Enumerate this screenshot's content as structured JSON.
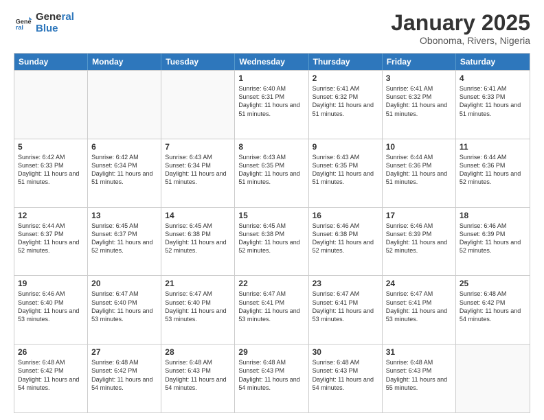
{
  "header": {
    "logo_line1": "General",
    "logo_line2": "Blue",
    "main_title": "January 2025",
    "subtitle": "Obonoma, Rivers, Nigeria"
  },
  "days_of_week": [
    "Sunday",
    "Monday",
    "Tuesday",
    "Wednesday",
    "Thursday",
    "Friday",
    "Saturday"
  ],
  "weeks": [
    [
      {
        "day": "",
        "sunrise": "",
        "sunset": "",
        "daylight": ""
      },
      {
        "day": "",
        "sunrise": "",
        "sunset": "",
        "daylight": ""
      },
      {
        "day": "",
        "sunrise": "",
        "sunset": "",
        "daylight": ""
      },
      {
        "day": "1",
        "sunrise": "Sunrise: 6:40 AM",
        "sunset": "Sunset: 6:31 PM",
        "daylight": "Daylight: 11 hours and 51 minutes."
      },
      {
        "day": "2",
        "sunrise": "Sunrise: 6:41 AM",
        "sunset": "Sunset: 6:32 PM",
        "daylight": "Daylight: 11 hours and 51 minutes."
      },
      {
        "day": "3",
        "sunrise": "Sunrise: 6:41 AM",
        "sunset": "Sunset: 6:32 PM",
        "daylight": "Daylight: 11 hours and 51 minutes."
      },
      {
        "day": "4",
        "sunrise": "Sunrise: 6:41 AM",
        "sunset": "Sunset: 6:33 PM",
        "daylight": "Daylight: 11 hours and 51 minutes."
      }
    ],
    [
      {
        "day": "5",
        "sunrise": "Sunrise: 6:42 AM",
        "sunset": "Sunset: 6:33 PM",
        "daylight": "Daylight: 11 hours and 51 minutes."
      },
      {
        "day": "6",
        "sunrise": "Sunrise: 6:42 AM",
        "sunset": "Sunset: 6:34 PM",
        "daylight": "Daylight: 11 hours and 51 minutes."
      },
      {
        "day": "7",
        "sunrise": "Sunrise: 6:43 AM",
        "sunset": "Sunset: 6:34 PM",
        "daylight": "Daylight: 11 hours and 51 minutes."
      },
      {
        "day": "8",
        "sunrise": "Sunrise: 6:43 AM",
        "sunset": "Sunset: 6:35 PM",
        "daylight": "Daylight: 11 hours and 51 minutes."
      },
      {
        "day": "9",
        "sunrise": "Sunrise: 6:43 AM",
        "sunset": "Sunset: 6:35 PM",
        "daylight": "Daylight: 11 hours and 51 minutes."
      },
      {
        "day": "10",
        "sunrise": "Sunrise: 6:44 AM",
        "sunset": "Sunset: 6:36 PM",
        "daylight": "Daylight: 11 hours and 51 minutes."
      },
      {
        "day": "11",
        "sunrise": "Sunrise: 6:44 AM",
        "sunset": "Sunset: 6:36 PM",
        "daylight": "Daylight: 11 hours and 52 minutes."
      }
    ],
    [
      {
        "day": "12",
        "sunrise": "Sunrise: 6:44 AM",
        "sunset": "Sunset: 6:37 PM",
        "daylight": "Daylight: 11 hours and 52 minutes."
      },
      {
        "day": "13",
        "sunrise": "Sunrise: 6:45 AM",
        "sunset": "Sunset: 6:37 PM",
        "daylight": "Daylight: 11 hours and 52 minutes."
      },
      {
        "day": "14",
        "sunrise": "Sunrise: 6:45 AM",
        "sunset": "Sunset: 6:38 PM",
        "daylight": "Daylight: 11 hours and 52 minutes."
      },
      {
        "day": "15",
        "sunrise": "Sunrise: 6:45 AM",
        "sunset": "Sunset: 6:38 PM",
        "daylight": "Daylight: 11 hours and 52 minutes."
      },
      {
        "day": "16",
        "sunrise": "Sunrise: 6:46 AM",
        "sunset": "Sunset: 6:38 PM",
        "daylight": "Daylight: 11 hours and 52 minutes."
      },
      {
        "day": "17",
        "sunrise": "Sunrise: 6:46 AM",
        "sunset": "Sunset: 6:39 PM",
        "daylight": "Daylight: 11 hours and 52 minutes."
      },
      {
        "day": "18",
        "sunrise": "Sunrise: 6:46 AM",
        "sunset": "Sunset: 6:39 PM",
        "daylight": "Daylight: 11 hours and 52 minutes."
      }
    ],
    [
      {
        "day": "19",
        "sunrise": "Sunrise: 6:46 AM",
        "sunset": "Sunset: 6:40 PM",
        "daylight": "Daylight: 11 hours and 53 minutes."
      },
      {
        "day": "20",
        "sunrise": "Sunrise: 6:47 AM",
        "sunset": "Sunset: 6:40 PM",
        "daylight": "Daylight: 11 hours and 53 minutes."
      },
      {
        "day": "21",
        "sunrise": "Sunrise: 6:47 AM",
        "sunset": "Sunset: 6:40 PM",
        "daylight": "Daylight: 11 hours and 53 minutes."
      },
      {
        "day": "22",
        "sunrise": "Sunrise: 6:47 AM",
        "sunset": "Sunset: 6:41 PM",
        "daylight": "Daylight: 11 hours and 53 minutes."
      },
      {
        "day": "23",
        "sunrise": "Sunrise: 6:47 AM",
        "sunset": "Sunset: 6:41 PM",
        "daylight": "Daylight: 11 hours and 53 minutes."
      },
      {
        "day": "24",
        "sunrise": "Sunrise: 6:47 AM",
        "sunset": "Sunset: 6:41 PM",
        "daylight": "Daylight: 11 hours and 53 minutes."
      },
      {
        "day": "25",
        "sunrise": "Sunrise: 6:48 AM",
        "sunset": "Sunset: 6:42 PM",
        "daylight": "Daylight: 11 hours and 54 minutes."
      }
    ],
    [
      {
        "day": "26",
        "sunrise": "Sunrise: 6:48 AM",
        "sunset": "Sunset: 6:42 PM",
        "daylight": "Daylight: 11 hours and 54 minutes."
      },
      {
        "day": "27",
        "sunrise": "Sunrise: 6:48 AM",
        "sunset": "Sunset: 6:42 PM",
        "daylight": "Daylight: 11 hours and 54 minutes."
      },
      {
        "day": "28",
        "sunrise": "Sunrise: 6:48 AM",
        "sunset": "Sunset: 6:43 PM",
        "daylight": "Daylight: 11 hours and 54 minutes."
      },
      {
        "day": "29",
        "sunrise": "Sunrise: 6:48 AM",
        "sunset": "Sunset: 6:43 PM",
        "daylight": "Daylight: 11 hours and 54 minutes."
      },
      {
        "day": "30",
        "sunrise": "Sunrise: 6:48 AM",
        "sunset": "Sunset: 6:43 PM",
        "daylight": "Daylight: 11 hours and 54 minutes."
      },
      {
        "day": "31",
        "sunrise": "Sunrise: 6:48 AM",
        "sunset": "Sunset: 6:43 PM",
        "daylight": "Daylight: 11 hours and 55 minutes."
      },
      {
        "day": "",
        "sunrise": "",
        "sunset": "",
        "daylight": ""
      }
    ]
  ]
}
